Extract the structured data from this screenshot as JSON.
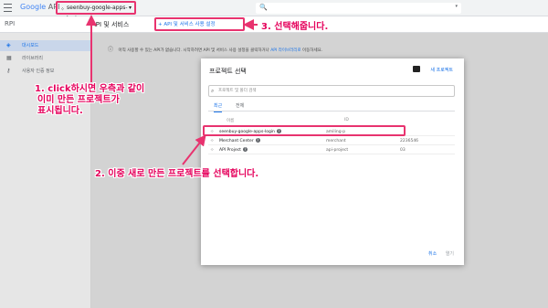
{
  "topbar": {
    "logo_google": "Google",
    "logo_suffix": "API",
    "project_name": "seenbuy-google-apps-login",
    "caret": "▾",
    "search_icon": "🔍",
    "search_caret": "▾"
  },
  "nav": {
    "rpi": "RPI",
    "api_title": "API 및 서비스",
    "enable_apis": "+ API 및 서비스 사용 설정"
  },
  "sidebar": {
    "items": [
      {
        "icon": "dashboard-icon",
        "glyph": "◈",
        "label": "대시보드"
      },
      {
        "icon": "library-icon",
        "glyph": "▦",
        "label": "라이브러리"
      },
      {
        "icon": "key-icon",
        "glyph": "⚷",
        "label": "사용자 인증 정보"
      }
    ]
  },
  "infobar": {
    "text": "아직 사용할 수 있는 API가 없습니다. 시작하려면 API 및 서비스 사용 설정을 클릭하거나",
    "link": "API 라이브러리로",
    "suffix": "이동하세요."
  },
  "dialog": {
    "title": "프로젝트 선택",
    "new_project": "새 프로젝트",
    "search_placeholder": "프로젝트 및 폴더 검색",
    "tabs": [
      "최근",
      "전체"
    ],
    "columns": {
      "name": "이름",
      "id": "ID"
    },
    "rows": [
      {
        "name": "seenbuy-google-apps-login",
        "id": "amiling-p",
        "number": ""
      },
      {
        "name": "Merchant Center",
        "id": "merchant",
        "number": "2236546"
      },
      {
        "name": "API Project",
        "id": "api-project",
        "number": "03"
      }
    ],
    "cancel": "취소",
    "open": "열기"
  },
  "annotations": {
    "step1_lines": [
      "1. click하시면 우측과 같이",
      "이미 만든 프로젝트가",
      "표시됩니다."
    ],
    "step2": "2. 이중 새로 만든 프로젝트를 선택합니다.",
    "step3": "3. 선택해줍니다."
  },
  "colors": {
    "annotation": "#e8336f",
    "link": "#1a73e8"
  }
}
